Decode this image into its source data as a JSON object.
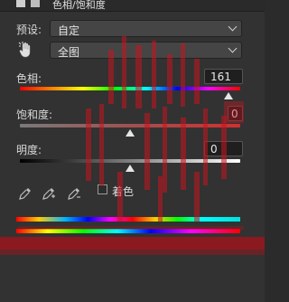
{
  "window": {
    "title": "色相/饱和度"
  },
  "preset": {
    "label": "预设:",
    "value": "自定"
  },
  "channel": {
    "value": "全图"
  },
  "hue": {
    "label": "色相:",
    "value": "161",
    "level": 161
  },
  "saturation": {
    "label": "饱和度:",
    "value": "0",
    "level": 0
  },
  "lightness": {
    "label": "明度:",
    "value": "0",
    "level": 0
  },
  "colorize": {
    "label": "着色",
    "checked": false
  },
  "icons": {
    "targeted_adjust": "hand-icon",
    "eyedropper": "eyedropper-icon",
    "eyedropper_add": "eyedropper-plus-icon",
    "eyedropper_subtract": "eyedropper-minus-icon"
  },
  "colors": {
    "panel": "#323232",
    "field": "#454545",
    "accent_red": "#c8141e"
  }
}
